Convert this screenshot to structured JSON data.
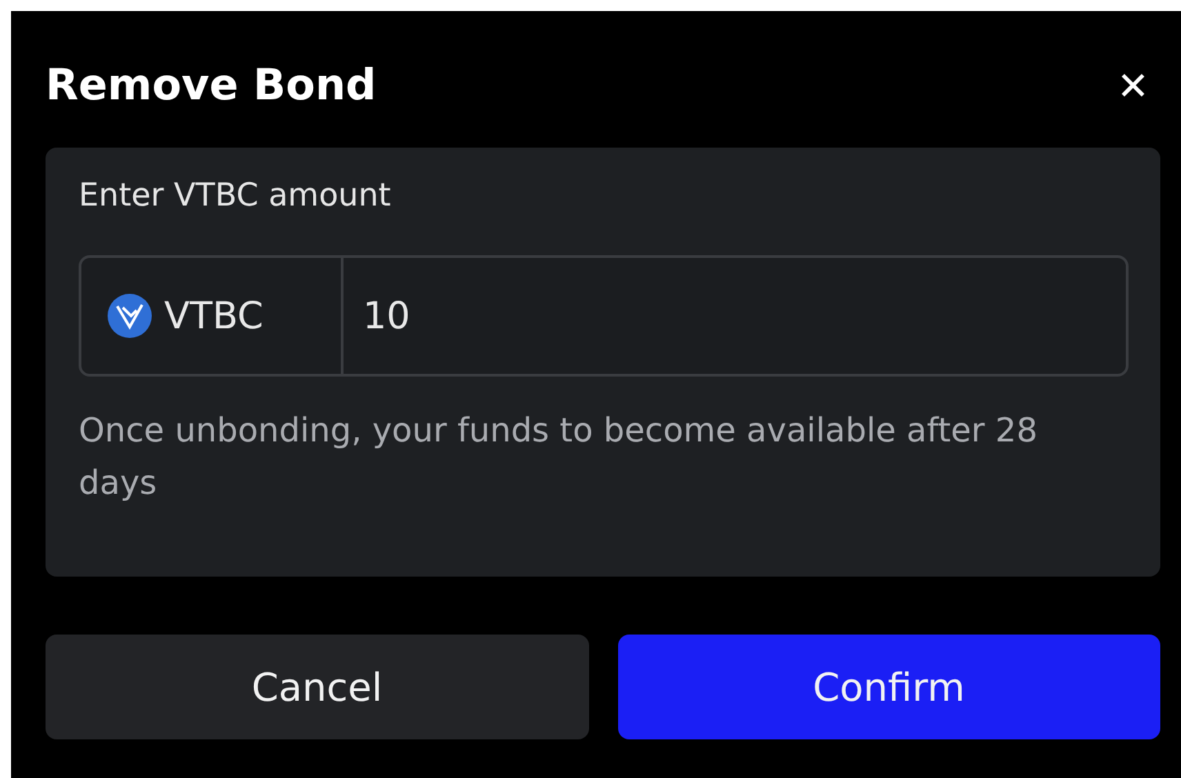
{
  "dialog": {
    "title": "Remove Bond",
    "close": "✕"
  },
  "amount": {
    "label": "Enter VTBC amount",
    "token": "VTBC",
    "value": "10",
    "note": "Once unbonding, your funds to become available after 28 days"
  },
  "buttons": [
    {
      "label": "Cancel",
      "kind": "secondary"
    },
    {
      "label": "Confirm",
      "kind": "primary"
    }
  ]
}
